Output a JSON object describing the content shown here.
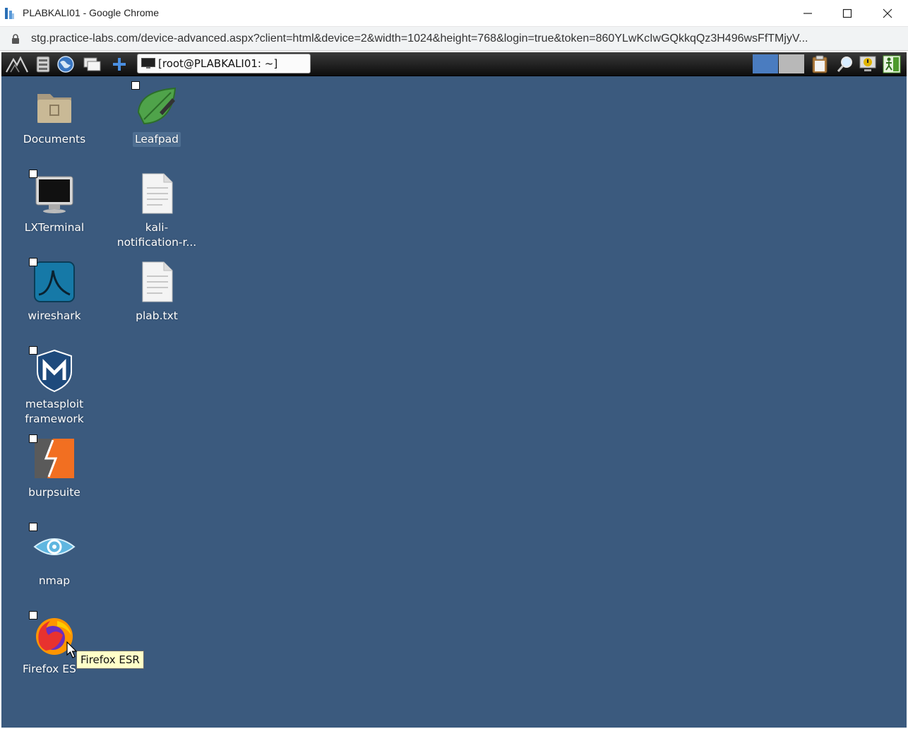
{
  "window": {
    "title": "PLABKALI01 - Google Chrome",
    "url": "stg.practice-labs.com/device-advanced.aspx?client=html&device=2&width=1024&height=768&login=true&token=860YLwKcIwGQkkqQz3H496wsFfTMjyV..."
  },
  "taskbar": {
    "task_label": "[root@PLABKALI01: ~]",
    "workspace_active_color": "#4a7cc0",
    "workspace_inactive_color": "#b8b8b8"
  },
  "desktop": {
    "background_color": "#3b5a7e",
    "icons": [
      {
        "label": "Documents",
        "icon": "folder-icon"
      },
      {
        "label": "Leafpad",
        "icon": "leafpad-icon"
      },
      {
        "label": "LXTerminal",
        "icon": "terminal-icon"
      },
      {
        "label": "kali-notification-r...",
        "label_line1": "kali-",
        "label_line2": "notification-r...",
        "icon": "text-file-icon"
      },
      {
        "label": "wireshark",
        "icon": "wireshark-icon"
      },
      {
        "label": "plab.txt",
        "icon": "text-file-icon"
      },
      {
        "label": "metasploit framework",
        "label_line1": "metasploit",
        "label_line2": "framework",
        "icon": "metasploit-icon"
      },
      {
        "label": "burpsuite",
        "icon": "burpsuite-icon"
      },
      {
        "label": "nmap",
        "icon": "nmap-icon"
      },
      {
        "label": "Firefox ESR",
        "visible_label": "Firefox ES",
        "icon": "firefox-icon"
      }
    ],
    "tooltip": "Firefox ESR"
  }
}
